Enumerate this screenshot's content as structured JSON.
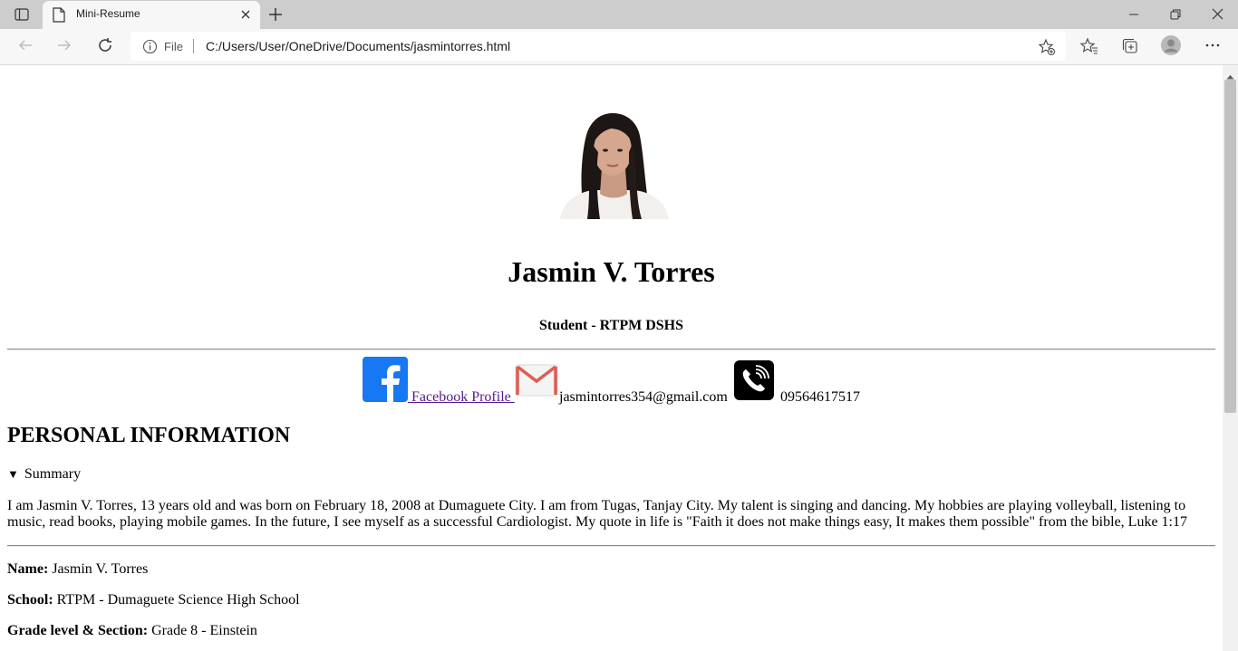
{
  "browser": {
    "tab_title": "Mini-Resume",
    "address_scheme": "File",
    "address_url": "C:/Users/User/OneDrive/Documents/jasmintorres.html"
  },
  "page": {
    "name": "Jasmin V. Torres",
    "role": "Student - RTPM DSHS",
    "contacts": {
      "facebook_label": " Facebook Profile ",
      "email": "jasmintorres354@gmail.com",
      "phone": "09564617517"
    },
    "section_title": "PERSONAL INFORMATION",
    "summary_label": "Summary",
    "summary_text": "I am Jasmin V. Torres, 13 years old and was born on February 18, 2008 at Dumaguete City. I am from Tugas, Tanjay City. My talent is singing and dancing. My hobbies are playing volleyball, listening to music, read books, playing mobile games. In the future, I see myself as a successful Cardiologist. My quote in life is \"Faith it does not make things easy, It makes them possible\" from the bible, Luke 1:17",
    "fields": [
      {
        "label": "Name:",
        "value": " Jasmin V. Torres"
      },
      {
        "label": "School:",
        "value": " RTPM - Dumaguete Science High School"
      },
      {
        "label": "Grade level & Section:",
        "value": " Grade 8 - Einstein"
      }
    ]
  },
  "colors": {
    "link_visited": "#551a8b",
    "facebook_blue": "#1877f2",
    "chrome_bg": "#cdcdcd"
  },
  "icons": [
    "tab-actions-icon",
    "page-icon",
    "close-icon",
    "plus-icon",
    "minimize-icon",
    "restore-icon",
    "window-close-icon",
    "back-icon",
    "forward-icon",
    "refresh-icon",
    "info-icon",
    "add-favorite-icon",
    "favorites-icon",
    "collections-icon",
    "profile-icon",
    "more-icon",
    "facebook-icon",
    "gmail-icon",
    "phone-icon"
  ]
}
